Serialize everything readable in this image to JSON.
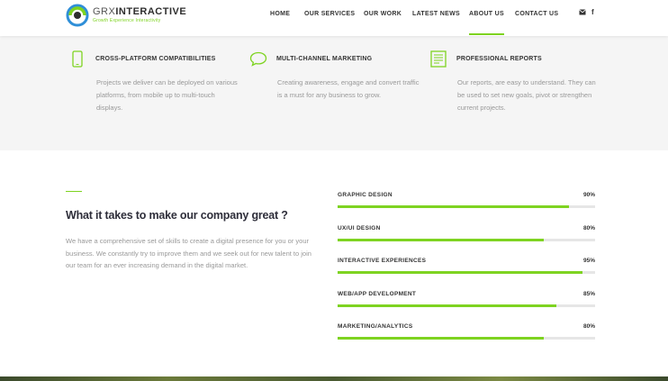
{
  "brand": {
    "name_bold": "GRX",
    "name_rest": "INTERACTIVE",
    "tagline": "Growth Experience Interactivity",
    "accent": "#7ed321"
  },
  "nav": {
    "items": [
      {
        "label": "HOME",
        "active": false
      },
      {
        "label": "OUR SERVICES",
        "active": false
      },
      {
        "label": "OUR WORK",
        "active": false
      },
      {
        "label": "LATEST NEWS",
        "active": false
      },
      {
        "label": "ABOUT US",
        "active": true
      },
      {
        "label": "CONTACT US",
        "active": false
      }
    ],
    "icons": [
      "envelope-icon",
      "facebook-icon"
    ]
  },
  "features": [
    {
      "icon": "mobile-icon",
      "title": "CROSS-PLATFORM COMPATIBILITIES",
      "text": "Projects we deliver can be deployed on various platforms, from mobile up to multi-touch displays."
    },
    {
      "icon": "chat-bubble-icon",
      "title": "MULTI-CHANNEL MARKETING",
      "text": "Creating awareness, engage and convert traffic is a must for any business to grow."
    },
    {
      "icon": "report-icon",
      "title": "PROFESSIONAL REPORTS",
      "text": "Our reports, are easy to understand. They can be used to set new goals, pivot or strengthen current projects."
    }
  ],
  "about": {
    "title": "What it takes to make our company great ?",
    "text": "We have a comprehensive set of skills to create a digital presence for you or your business. We constantly try to improve them and we seek out for new talent to join our team for an ever increasing demand in the digital market."
  },
  "skills": [
    {
      "label": "GRAPHIC DESIGN",
      "percent": "90%",
      "value": 90
    },
    {
      "label": "UX/UI DESIGN",
      "percent": "80%",
      "value": 80
    },
    {
      "label": "INTERACTIVE EXPERIENCES",
      "percent": "95%",
      "value": 95
    },
    {
      "label": "WEB/APP DEVELOPMENT",
      "percent": "85%",
      "value": 85
    },
    {
      "label": "MARKETING/ANALYTICS",
      "percent": "80%",
      "value": 80
    }
  ]
}
